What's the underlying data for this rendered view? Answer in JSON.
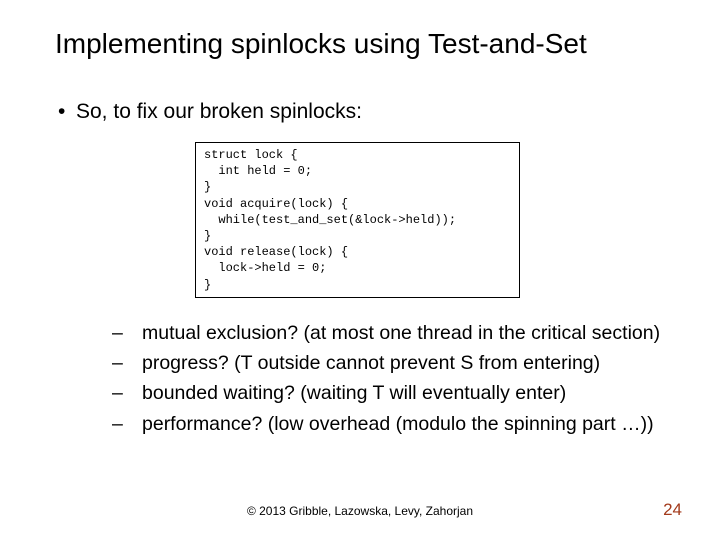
{
  "title": "Implementing spinlocks using Test-and-Set",
  "main_bullet": {
    "marker": "•",
    "text": "So, to fix our broken spinlocks:"
  },
  "code": "struct lock {\n  int held = 0;\n}\nvoid acquire(lock) {\n  while(test_and_set(&lock->held));\n}\nvoid release(lock) {\n  lock->held = 0;\n}",
  "sub_bullets": [
    {
      "marker": "–",
      "text": "mutual exclusion? (at most one thread in the critical section)"
    },
    {
      "marker": "–",
      "text": "progress? (T outside cannot prevent S from entering)"
    },
    {
      "marker": "–",
      "text": "bounded waiting? (waiting T will eventually enter)"
    },
    {
      "marker": "–",
      "text": "performance? (low overhead (modulo the spinning part …))"
    }
  ],
  "footer": "© 2013 Gribble, Lazowska, Levy, Zahorjan",
  "page_number": "24"
}
